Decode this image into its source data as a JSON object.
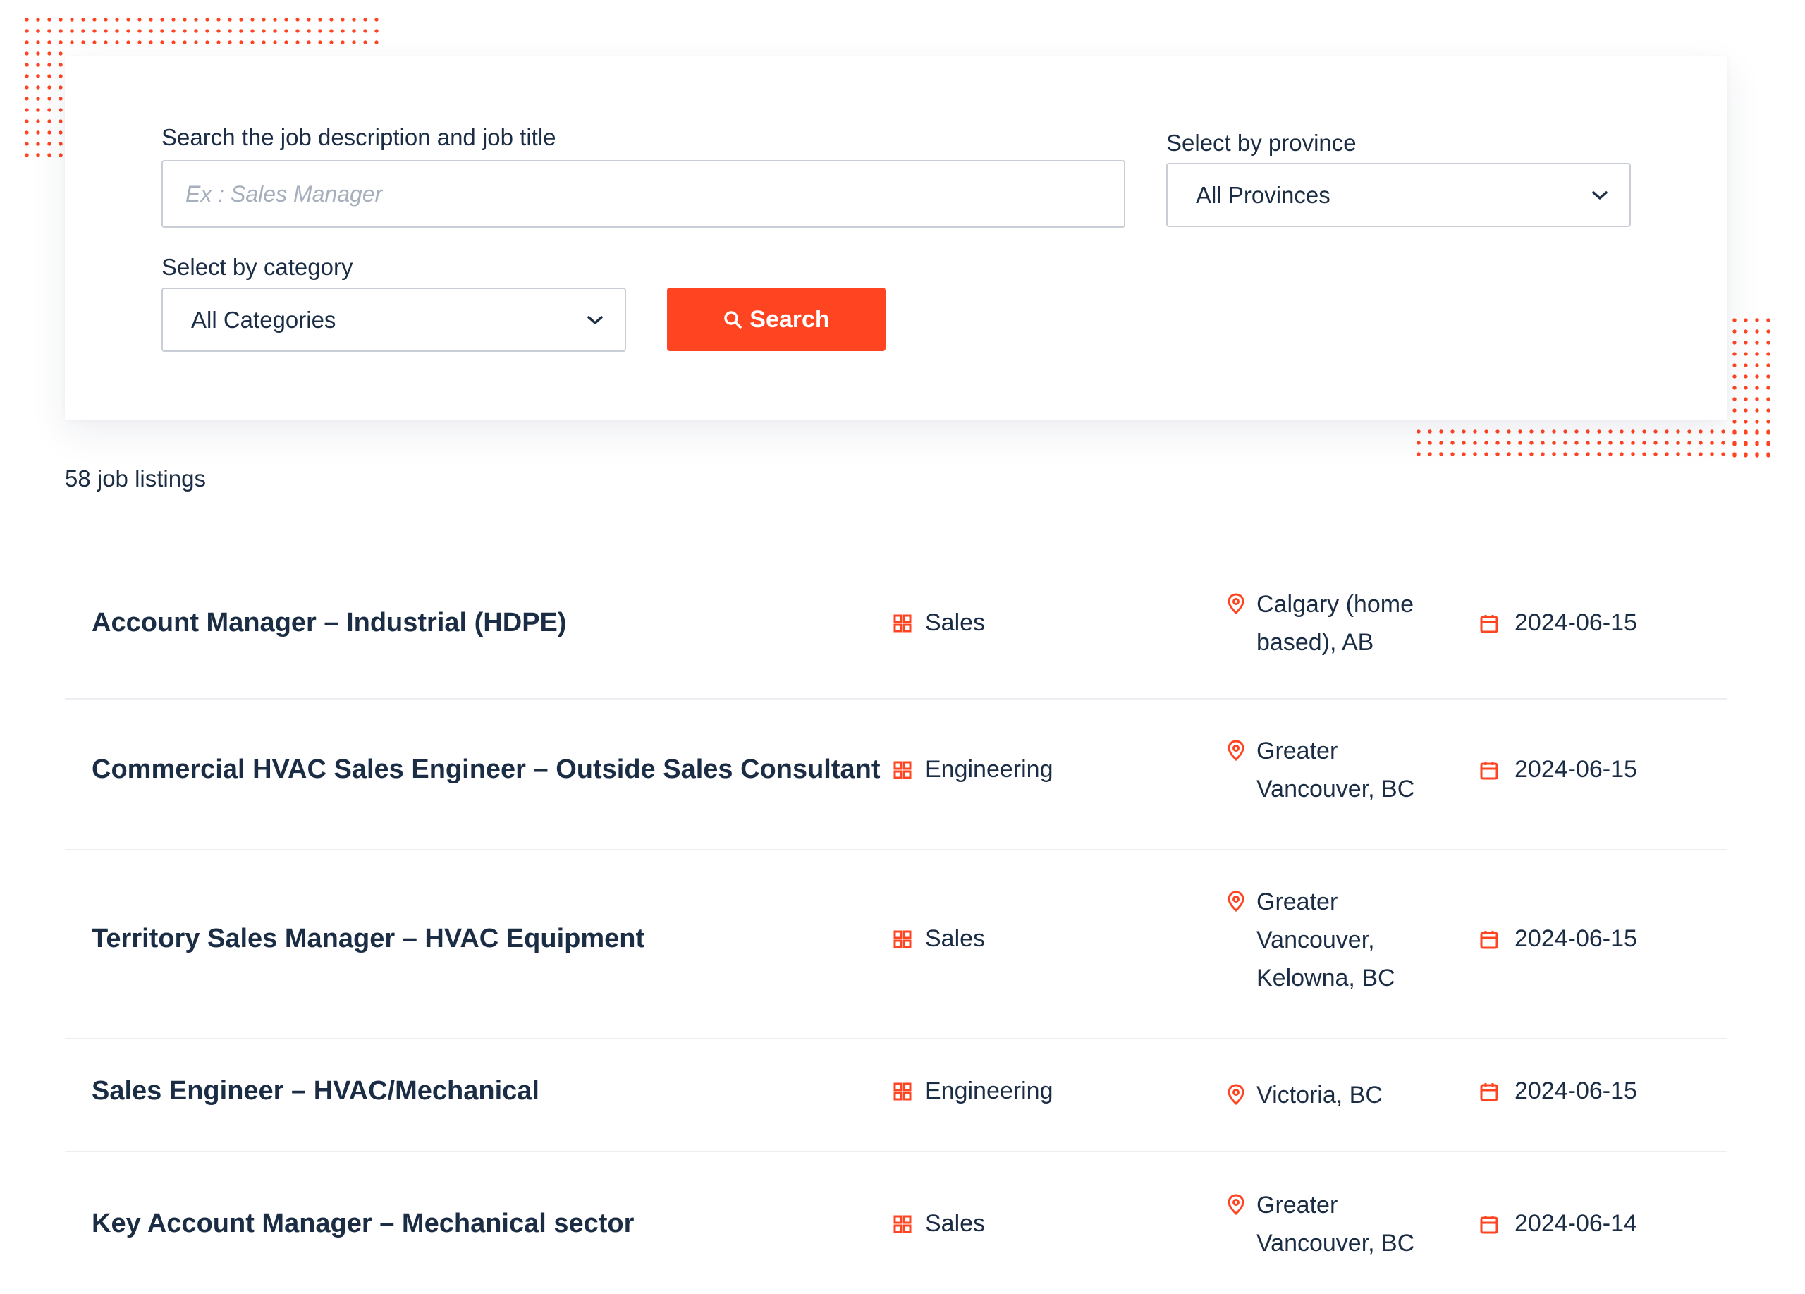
{
  "search": {
    "keyword_label": "Search the job description and job title",
    "keyword_placeholder": "Ex : Sales Manager",
    "province_label": "Select by province",
    "province_value": "All Provinces",
    "category_label": "Select by category",
    "category_value": "All Categories",
    "button_label": "Search"
  },
  "results": {
    "count_text": "58 job listings"
  },
  "listings": [
    {
      "title": "Account Manager – Industrial (HDPE)",
      "category": "Sales",
      "location": "Calgary (home based), AB",
      "date": "2024-06-15"
    },
    {
      "title": "Commercial HVAC Sales Engineer – Outside Sales Consultant",
      "category": "Engineering",
      "location": "Greater Vancouver, BC",
      "date": "2024-06-15"
    },
    {
      "title": "Territory Sales Manager – HVAC Equipment",
      "category": "Sales",
      "location": "Greater Vancouver, Kelowna, BC",
      "date": "2024-06-15"
    },
    {
      "title": "Sales Engineer – HVAC/Mechanical",
      "category": "Engineering",
      "location": "Victoria, BC",
      "date": "2024-06-15"
    },
    {
      "title": "Key Account Manager – Mechanical sector",
      "category": "Sales",
      "location": "Greater Vancouver, BC",
      "date": "2024-06-14"
    }
  ],
  "icons": {
    "category": "grid-icon",
    "location": "map-pin-icon",
    "date": "calendar-icon",
    "search": "search-icon",
    "dropdown": "chevron-down-icon"
  },
  "colors": {
    "accent": "#ff4422",
    "text": "#1b2d44",
    "border": "#c9ced6",
    "placeholder": "#a6afbb"
  }
}
